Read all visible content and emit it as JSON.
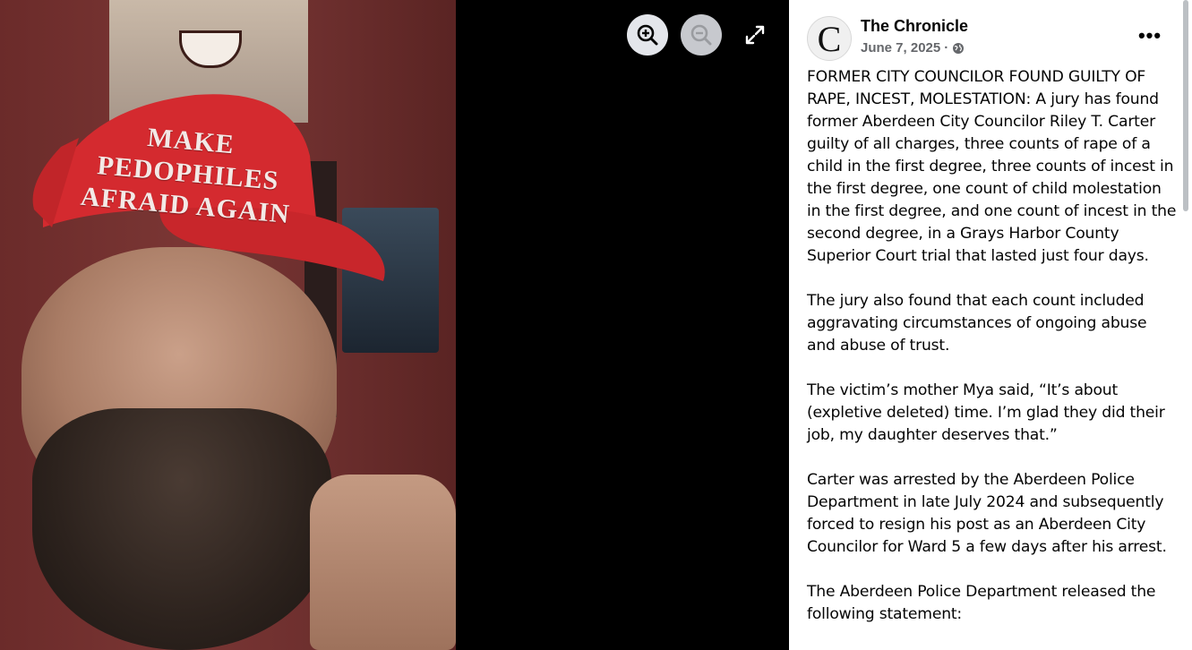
{
  "viewer": {
    "photo_text": {
      "line1": "MAKE PEDOPHILES",
      "line2": "AFRAID AGAIN"
    },
    "controls": {
      "zoom_in_icon": "zoom-in-icon",
      "zoom_out_icon": "zoom-out-icon",
      "fullscreen_icon": "fullscreen-icon"
    }
  },
  "post": {
    "page_name": "The Chronicle",
    "avatar_letter": "C",
    "date": "June 7, 2025",
    "separator": "·",
    "privacy_icon": "globe-icon",
    "more_label": "•••",
    "paragraphs": [
      "FORMER CITY COUNCILOR FOUND GUILTY OF RAPE, INCEST, MOLESTATION: A jury has found former Aberdeen City Councilor Riley T. Carter guilty of all charges, three counts of rape of a child in the first degree, three counts of incest in the first degree, one count of child molestation in the first degree, and one count of incest in the second degree, in a Grays Harbor County Superior Court trial that lasted just four days.",
      "The jury also found that each count included aggravating circumstances of ongoing abuse and abuse of trust.",
      "The victim’s mother Mya said, “It’s about (expletive deleted) time. I’m glad they did their job, my daughter deserves that.”",
      "Carter was arrested by the Aberdeen Police Department in late July 2024 and subsequently forced to resign his post as an Aberdeen City Councilor for Ward 5 a few days after his arrest.",
      "The Aberdeen Police Department released the following statement:"
    ]
  },
  "colors": {
    "panel_bg": "#ffffff",
    "viewer_bg": "#000000",
    "hat_red": "#d42a2f",
    "button_bg": "#e4e6eb",
    "meta_gray": "#65676b"
  }
}
